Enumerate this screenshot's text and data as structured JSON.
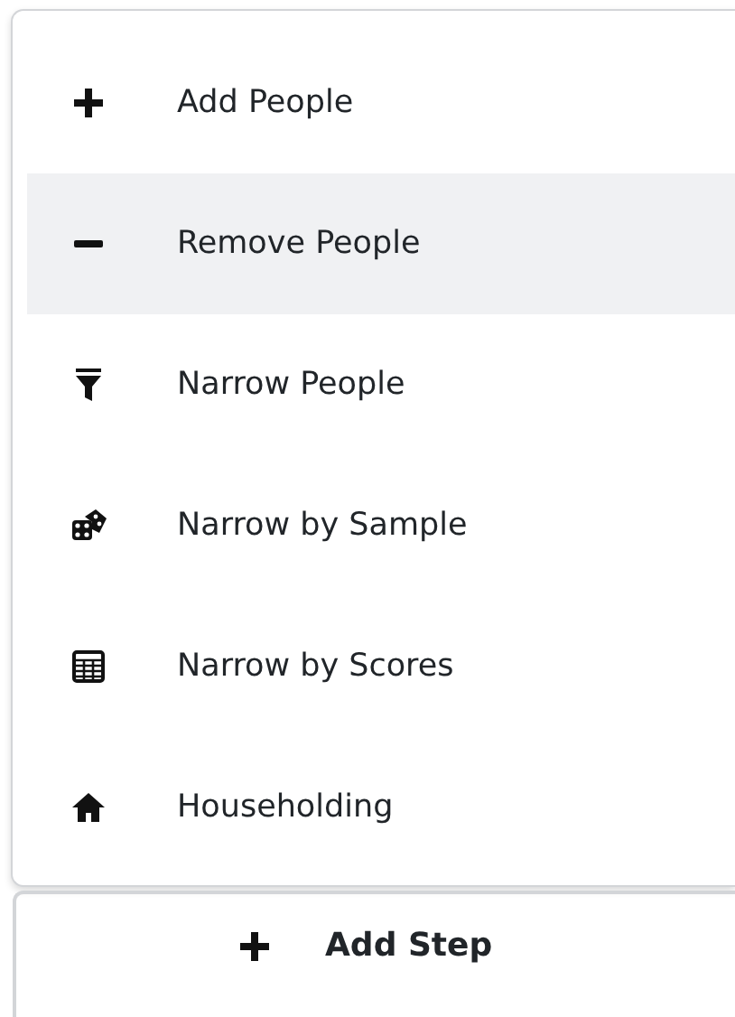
{
  "menu": {
    "items": [
      {
        "label": "Add People",
        "selected": false
      },
      {
        "label": "Remove People",
        "selected": true
      },
      {
        "label": "Narrow People",
        "selected": false
      },
      {
        "label": "Narrow by Sample",
        "selected": false
      },
      {
        "label": "Narrow by Scores",
        "selected": false
      },
      {
        "label": "Householding",
        "selected": false
      }
    ]
  },
  "add_step": {
    "label": "Add Step"
  }
}
